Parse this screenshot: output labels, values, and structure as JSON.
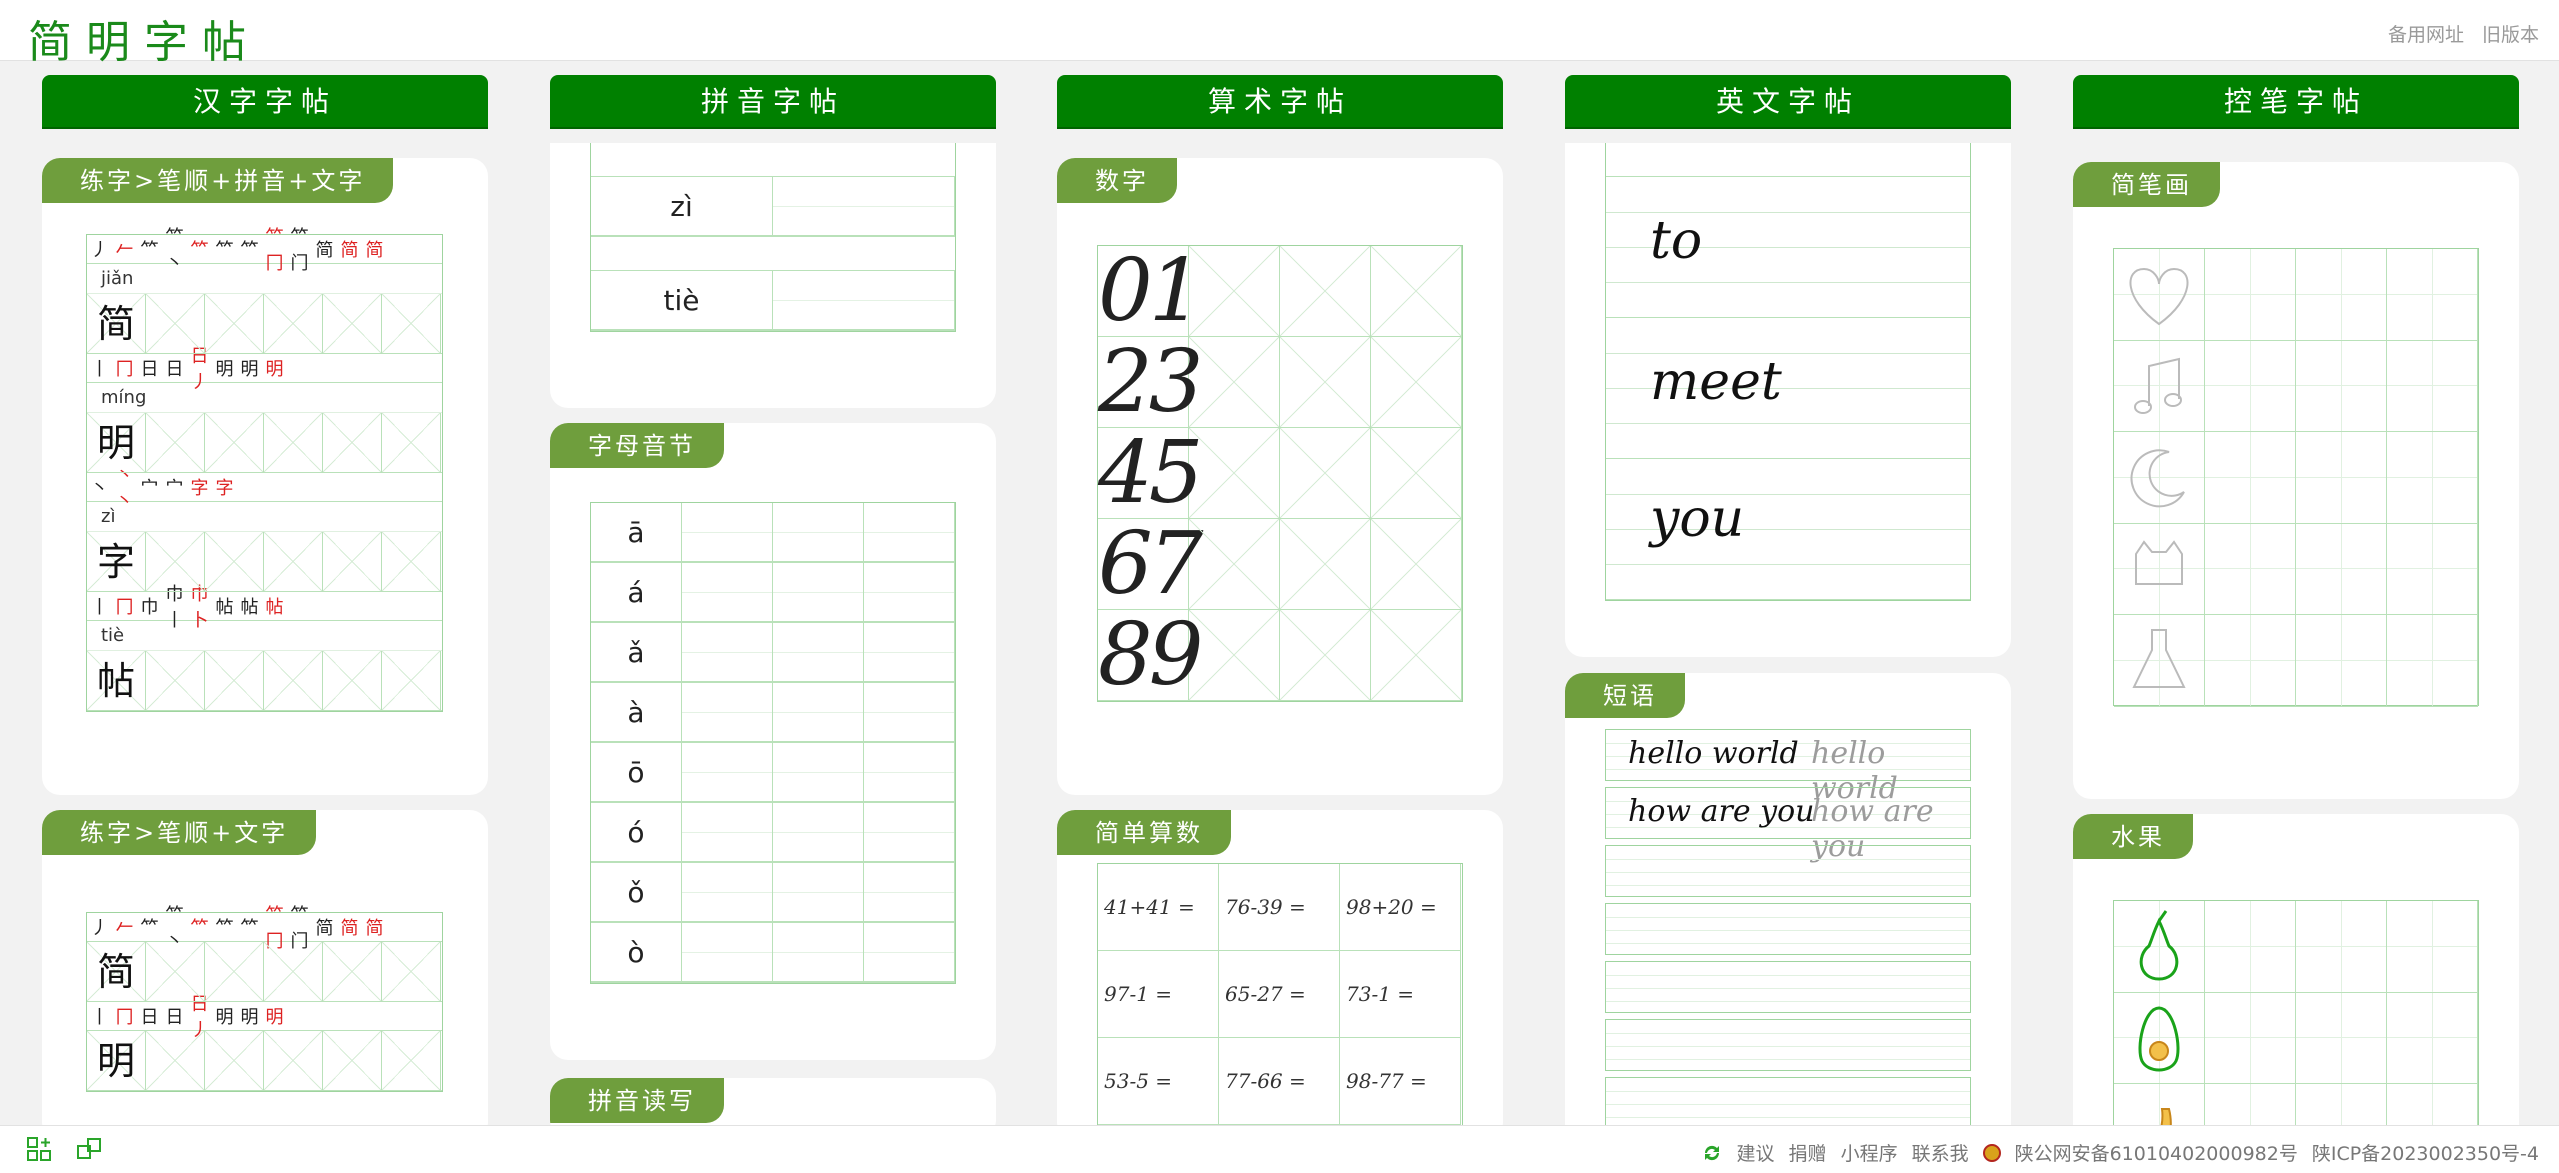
{
  "header": {
    "logo": "简明字帖",
    "links": [
      "备用网址",
      "旧版本"
    ]
  },
  "columns": {
    "hanzi": {
      "title": "汉字字帖",
      "card1_tag": "练字>笔顺+拼音+文字",
      "card2_tag": "练字>笔顺+文字",
      "chars": [
        {
          "pinyin": "jiǎn",
          "char": "简",
          "strokes": [
            "丿",
            "𠂉",
            "𥫗",
            "𥫗丶",
            "𥫗",
            "𥫗",
            "𥫗",
            "𥫗冂",
            "𥫗门",
            "简",
            "简",
            "简"
          ]
        },
        {
          "pinyin": "míng",
          "char": "明",
          "strokes": [
            "丨",
            "冂",
            "日",
            "日",
            "日丿",
            "明",
            "明",
            "明"
          ]
        },
        {
          "pinyin": "zì",
          "char": "字",
          "strokes": [
            "丶",
            "丶丶",
            "宀",
            "宀",
            "字",
            "字"
          ]
        },
        {
          "pinyin": "tiè",
          "char": "帖",
          "strokes": [
            "丨",
            "冂",
            "巾",
            "巾丨",
            "巾卜",
            "帖",
            "帖",
            "帖"
          ]
        }
      ]
    },
    "pinyin": {
      "title": "拼音字帖",
      "card1_rows": [
        "zì",
        "tiè"
      ],
      "card2_tag": "字母音节",
      "card2_rows": [
        "ā",
        "á",
        "ǎ",
        "à",
        "ō",
        "ó",
        "ǒ",
        "ò"
      ],
      "card3_tag": "拼音读写"
    },
    "arith": {
      "title": "算术字帖",
      "card1_tag": "数字",
      "digits": [
        "01",
        "23",
        "45",
        "67",
        "89"
      ],
      "card2_tag": "简单算数",
      "calcs": [
        [
          "41+41 =",
          "76-39 =",
          "98+20 ="
        ],
        [
          "97-1 =",
          "65-27 =",
          "73-1 ="
        ],
        [
          "53-5 =",
          "77-66 =",
          "98-77 ="
        ]
      ]
    },
    "english": {
      "title": "英文字帖",
      "words": [
        "to",
        "meet",
        "you"
      ],
      "card2_tag": "短语",
      "phrases": [
        [
          "hello world",
          "hello world"
        ],
        [
          "how are you",
          "how are you"
        ]
      ]
    },
    "draw": {
      "title": "控笔字帖",
      "card1_tag": "简笔画",
      "card2_tag": "水果"
    }
  },
  "footer": {
    "links": [
      "建议",
      "捐赠",
      "小程序",
      "联系我"
    ],
    "police": "陕公网安备61010402000982号",
    "icp": "陕ICP备2023002350号-4"
  },
  "colors": {
    "brand": "#008000",
    "tag": "#6f9e3d",
    "grid": "#9fd49f"
  }
}
